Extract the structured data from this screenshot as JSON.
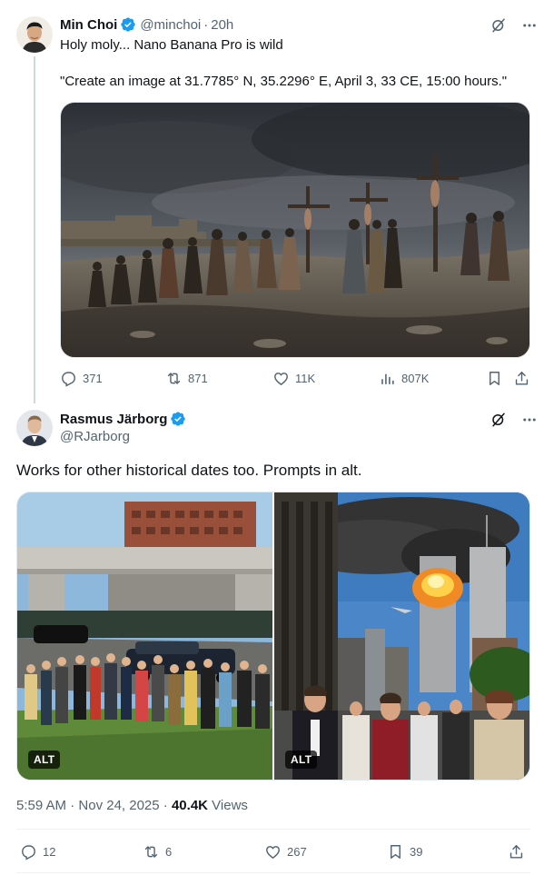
{
  "tweet1": {
    "author_name": "Min Choi",
    "author_handle": "@minchoi",
    "separator": "·",
    "time": "20h",
    "text_line1": "Holy moly... Nano Banana Pro is wild",
    "text_line2": "\"Create an image at 31.7785° N, 35.2296° E, April 3, 33 CE, 15:00 hours.\"",
    "stats": {
      "replies": "371",
      "reposts": "871",
      "likes": "11K",
      "views": "807K"
    }
  },
  "tweet2": {
    "author_name": "Rasmus Järborg",
    "author_handle": "@RJarborg",
    "text": "Works for other historical dates too. Prompts in alt.",
    "alt_label_left": "ALT",
    "alt_label_right": "ALT",
    "time": "5:59 AM",
    "separator": "·",
    "date": "Nov 24, 2025",
    "views_count": "40.4K",
    "views_label": "Views",
    "stats": {
      "replies": "12",
      "reposts": "6",
      "likes": "267",
      "bookmarks": "39"
    }
  },
  "colors": {
    "verified": "#1d9bf0",
    "muted": "#536471",
    "text": "#0f1419",
    "thread_line": "#cfd9de"
  },
  "icons": [
    "grok-icon",
    "more-icon",
    "reply-icon",
    "repost-icon",
    "like-icon",
    "views-icon",
    "bookmark-icon",
    "share-icon",
    "verified-icon"
  ]
}
